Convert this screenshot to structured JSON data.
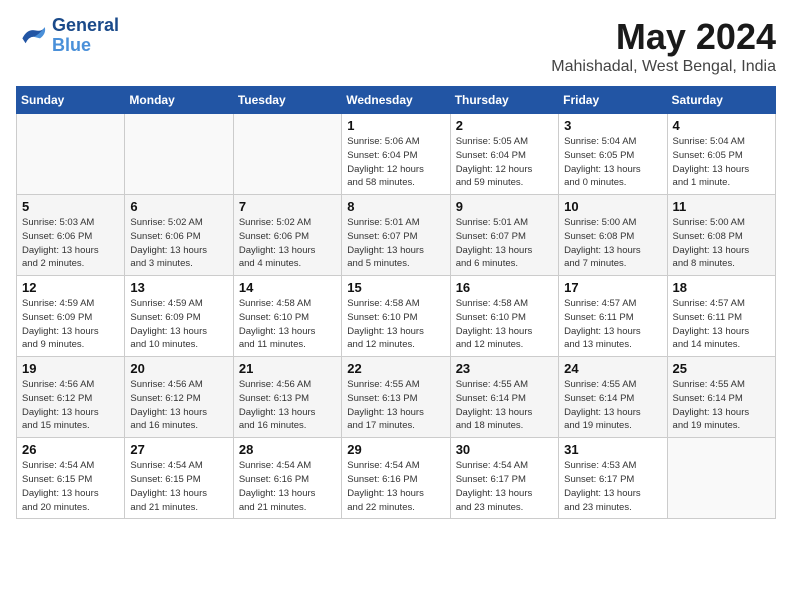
{
  "header": {
    "logo_line1": "General",
    "logo_line2": "Blue",
    "month": "May 2024",
    "location": "Mahishadal, West Bengal, India"
  },
  "days_of_week": [
    "Sunday",
    "Monday",
    "Tuesday",
    "Wednesday",
    "Thursday",
    "Friday",
    "Saturday"
  ],
  "weeks": [
    [
      {
        "day": "",
        "info": ""
      },
      {
        "day": "",
        "info": ""
      },
      {
        "day": "",
        "info": ""
      },
      {
        "day": "1",
        "info": "Sunrise: 5:06 AM\nSunset: 6:04 PM\nDaylight: 12 hours\nand 58 minutes."
      },
      {
        "day": "2",
        "info": "Sunrise: 5:05 AM\nSunset: 6:04 PM\nDaylight: 12 hours\nand 59 minutes."
      },
      {
        "day": "3",
        "info": "Sunrise: 5:04 AM\nSunset: 6:05 PM\nDaylight: 13 hours\nand 0 minutes."
      },
      {
        "day": "4",
        "info": "Sunrise: 5:04 AM\nSunset: 6:05 PM\nDaylight: 13 hours\nand 1 minute."
      }
    ],
    [
      {
        "day": "5",
        "info": "Sunrise: 5:03 AM\nSunset: 6:06 PM\nDaylight: 13 hours\nand 2 minutes."
      },
      {
        "day": "6",
        "info": "Sunrise: 5:02 AM\nSunset: 6:06 PM\nDaylight: 13 hours\nand 3 minutes."
      },
      {
        "day": "7",
        "info": "Sunrise: 5:02 AM\nSunset: 6:06 PM\nDaylight: 13 hours\nand 4 minutes."
      },
      {
        "day": "8",
        "info": "Sunrise: 5:01 AM\nSunset: 6:07 PM\nDaylight: 13 hours\nand 5 minutes."
      },
      {
        "day": "9",
        "info": "Sunrise: 5:01 AM\nSunset: 6:07 PM\nDaylight: 13 hours\nand 6 minutes."
      },
      {
        "day": "10",
        "info": "Sunrise: 5:00 AM\nSunset: 6:08 PM\nDaylight: 13 hours\nand 7 minutes."
      },
      {
        "day": "11",
        "info": "Sunrise: 5:00 AM\nSunset: 6:08 PM\nDaylight: 13 hours\nand 8 minutes."
      }
    ],
    [
      {
        "day": "12",
        "info": "Sunrise: 4:59 AM\nSunset: 6:09 PM\nDaylight: 13 hours\nand 9 minutes."
      },
      {
        "day": "13",
        "info": "Sunrise: 4:59 AM\nSunset: 6:09 PM\nDaylight: 13 hours\nand 10 minutes."
      },
      {
        "day": "14",
        "info": "Sunrise: 4:58 AM\nSunset: 6:10 PM\nDaylight: 13 hours\nand 11 minutes."
      },
      {
        "day": "15",
        "info": "Sunrise: 4:58 AM\nSunset: 6:10 PM\nDaylight: 13 hours\nand 12 minutes."
      },
      {
        "day": "16",
        "info": "Sunrise: 4:58 AM\nSunset: 6:10 PM\nDaylight: 13 hours\nand 12 minutes."
      },
      {
        "day": "17",
        "info": "Sunrise: 4:57 AM\nSunset: 6:11 PM\nDaylight: 13 hours\nand 13 minutes."
      },
      {
        "day": "18",
        "info": "Sunrise: 4:57 AM\nSunset: 6:11 PM\nDaylight: 13 hours\nand 14 minutes."
      }
    ],
    [
      {
        "day": "19",
        "info": "Sunrise: 4:56 AM\nSunset: 6:12 PM\nDaylight: 13 hours\nand 15 minutes."
      },
      {
        "day": "20",
        "info": "Sunrise: 4:56 AM\nSunset: 6:12 PM\nDaylight: 13 hours\nand 16 minutes."
      },
      {
        "day": "21",
        "info": "Sunrise: 4:56 AM\nSunset: 6:13 PM\nDaylight: 13 hours\nand 16 minutes."
      },
      {
        "day": "22",
        "info": "Sunrise: 4:55 AM\nSunset: 6:13 PM\nDaylight: 13 hours\nand 17 minutes."
      },
      {
        "day": "23",
        "info": "Sunrise: 4:55 AM\nSunset: 6:14 PM\nDaylight: 13 hours\nand 18 minutes."
      },
      {
        "day": "24",
        "info": "Sunrise: 4:55 AM\nSunset: 6:14 PM\nDaylight: 13 hours\nand 19 minutes."
      },
      {
        "day": "25",
        "info": "Sunrise: 4:55 AM\nSunset: 6:14 PM\nDaylight: 13 hours\nand 19 minutes."
      }
    ],
    [
      {
        "day": "26",
        "info": "Sunrise: 4:54 AM\nSunset: 6:15 PM\nDaylight: 13 hours\nand 20 minutes."
      },
      {
        "day": "27",
        "info": "Sunrise: 4:54 AM\nSunset: 6:15 PM\nDaylight: 13 hours\nand 21 minutes."
      },
      {
        "day": "28",
        "info": "Sunrise: 4:54 AM\nSunset: 6:16 PM\nDaylight: 13 hours\nand 21 minutes."
      },
      {
        "day": "29",
        "info": "Sunrise: 4:54 AM\nSunset: 6:16 PM\nDaylight: 13 hours\nand 22 minutes."
      },
      {
        "day": "30",
        "info": "Sunrise: 4:54 AM\nSunset: 6:17 PM\nDaylight: 13 hours\nand 23 minutes."
      },
      {
        "day": "31",
        "info": "Sunrise: 4:53 AM\nSunset: 6:17 PM\nDaylight: 13 hours\nand 23 minutes."
      },
      {
        "day": "",
        "info": ""
      }
    ]
  ]
}
